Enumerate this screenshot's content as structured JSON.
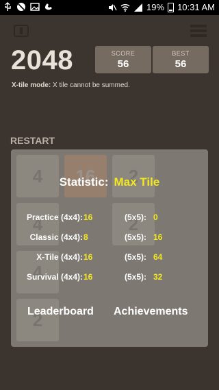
{
  "statusbar": {
    "battery": "19%",
    "time": "10:31 AM"
  },
  "header": {
    "title": "2048",
    "score_label": "SCORE",
    "score_value": "56",
    "best_label": "BEST",
    "best_value": "56"
  },
  "mode": {
    "label": "X-tile mode:",
    "description": "X tile cannot be summed."
  },
  "restart_label": "RESTART",
  "board_tiles": [
    "4",
    "16",
    "2",
    "4",
    "2",
    "4",
    "2"
  ],
  "statistic": {
    "label": "Statistic:",
    "value": "Max Tile",
    "rows": [
      {
        "mode": "Practice (4x4):",
        "v4": "16",
        "size5": "(5x5):",
        "v5": "0"
      },
      {
        "mode": "Classic (4x4):",
        "v4": "8",
        "size5": "(5x5):",
        "v5": "16"
      },
      {
        "mode": "X-Tile (4x4):",
        "v4": "16",
        "size5": "(5x5):",
        "v5": "64"
      },
      {
        "mode": "Survival (4x4):",
        "v4": "16",
        "size5": "(5x5):",
        "v5": "32"
      }
    ],
    "leaderboard_label": "Leaderboard",
    "achievements_label": "Achievements"
  }
}
